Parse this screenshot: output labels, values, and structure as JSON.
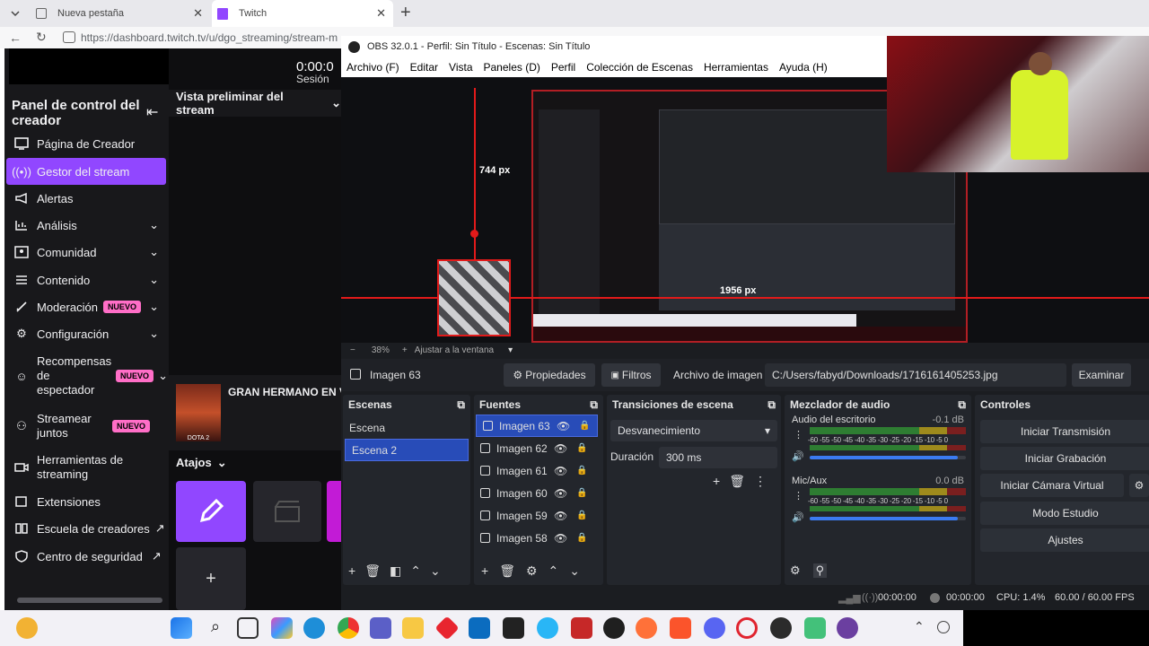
{
  "browser": {
    "tabs": [
      {
        "label": "Nueva pestaña"
      },
      {
        "label": "Twitch"
      }
    ],
    "url": "https://dashboard.twitch.tv/u/dgo_streaming/stream-m"
  },
  "twitch": {
    "timer": "0:00:0",
    "session": "Sesión",
    "panel_title": "Panel de control del creador",
    "preview_label": "Vista preliminar del stream",
    "nav": [
      {
        "label": "Página de Creador"
      },
      {
        "label": "Gestor del stream"
      },
      {
        "label": "Alertas"
      },
      {
        "label": "Análisis"
      },
      {
        "label": "Comunidad"
      },
      {
        "label": "Contenido"
      },
      {
        "label": "Moderación",
        "badge": "NUEVO"
      },
      {
        "label": "Configuración"
      },
      {
        "label": "Recompensas de espectador",
        "badge": "NUEVO"
      },
      {
        "label": "Streamear juntos",
        "badge": "NUEVO"
      },
      {
        "label": "Herramientas de streaming"
      },
      {
        "label": "Extensiones"
      },
      {
        "label": "Escuela de creadores"
      },
      {
        "label": "Centro de seguridad"
      }
    ],
    "game_title": "GRAN HERMANO EN V",
    "game_cover_text": "DOTA 2",
    "shortcuts_label": "Atajos",
    "add_glyph": "+"
  },
  "obs": {
    "title": "OBS 32.0.1 - Perfil: Sin Título - Escenas: Sin Título",
    "menu": [
      "Archivo (F)",
      "Editar",
      "Vista",
      "Paneles (D)",
      "Perfil",
      "Colección de Escenas",
      "Herramientas",
      "Ayuda (H)"
    ],
    "measure_v": "744 px",
    "measure_h": "1956 px",
    "zoom": "38%",
    "fit_label": "Ajustar a la ventana",
    "source_name": "Imagen 63",
    "props_btn": "Propiedades",
    "filters_btn": "Filtros",
    "image_file_label": "Archivo de imagen",
    "image_path": "C:/Users/fabyd/Downloads/1716161405253.jpg",
    "browse_btn": "Examinar",
    "scenes": {
      "title": "Escenas",
      "items": [
        "Escena",
        "Escena 2"
      ],
      "selected": "Escena 2"
    },
    "sources": {
      "title": "Fuentes",
      "items": [
        "Imagen 63",
        "Imagen 62",
        "Imagen 61",
        "Imagen 60",
        "Imagen 59",
        "Imagen 58"
      ]
    },
    "transitions": {
      "title": "Transiciones de escena",
      "type": "Desvanecimiento",
      "duration_label": "Duración",
      "duration": "300 ms"
    },
    "mixer": {
      "title": "Mezclador de audio",
      "channels": [
        {
          "name": "Audio del escritorio",
          "db": "-0.1 dB",
          "volume": 0.95
        },
        {
          "name": "Mic/Aux",
          "db": "0.0 dB",
          "volume": 0.95
        }
      ],
      "scale": "-60 -55 -50 -45 -40 -35 -30 -25 -20 -15 -10 -5 0"
    },
    "controls": {
      "title": "Controles",
      "buttons": [
        "Iniciar Transmisión",
        "Iniciar Grabación",
        "Iniciar Cámara Virtual",
        "Modo Estudio",
        "Ajustes"
      ]
    },
    "status": {
      "stream_time": "00:00:00",
      "rec_time": "00:00:00",
      "cpu": "CPU: 1.4%",
      "fps": "60.00 / 60.00 FPS"
    }
  },
  "colors": {
    "twitch_purple": "#9147ff",
    "obs_bg": "#1b1d21",
    "selected_blue": "#284cb8"
  }
}
